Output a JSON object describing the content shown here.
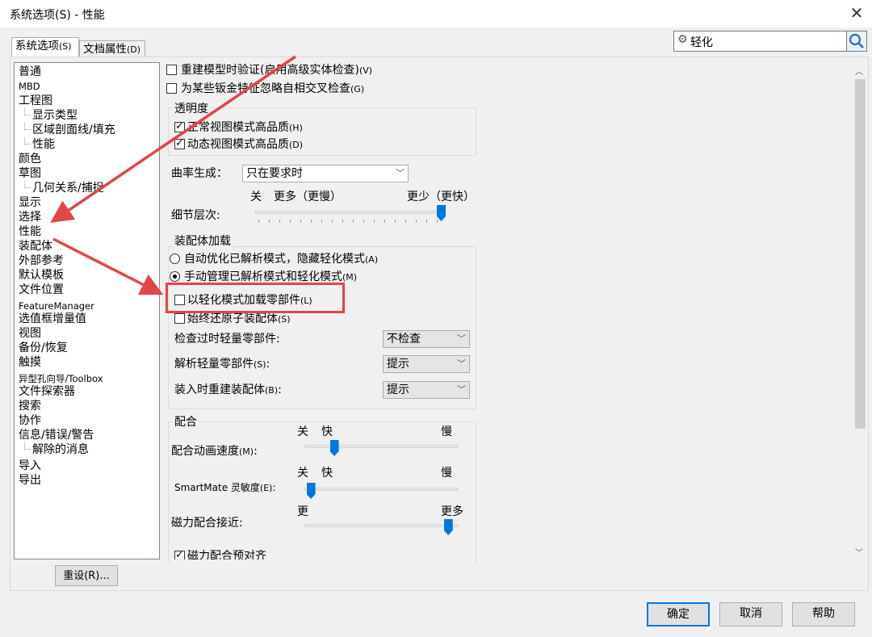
{
  "window": {
    "title": "系统选项(S) - 性能",
    "close_icon": "close-icon"
  },
  "tabs": [
    {
      "label": "系统选项",
      "shortcut": "(S)"
    },
    {
      "label": "文档属性",
      "shortcut": "(D)"
    }
  ],
  "search": {
    "value": "轻化",
    "gear_icon": "gear-icon",
    "search_icon": "search-icon"
  },
  "tree": {
    "items": [
      {
        "label": "普通"
      },
      {
        "label": "MBD"
      },
      {
        "label": "工程图"
      },
      {
        "label": "显示类型"
      },
      {
        "label": "区域剖面线/填充"
      },
      {
        "label": "性能"
      },
      {
        "label": "颜色"
      },
      {
        "label": "草图"
      },
      {
        "label": "几何关系/捕捉"
      },
      {
        "label": "显示"
      },
      {
        "label": "选择"
      },
      {
        "label": "性能"
      },
      {
        "label": "装配体"
      },
      {
        "label": "外部参考"
      },
      {
        "label": "默认模板"
      },
      {
        "label": "文件位置"
      },
      {
        "label": "FeatureManager"
      },
      {
        "label": "选值框增量值"
      },
      {
        "label": "视图"
      },
      {
        "label": "备份/恢复"
      },
      {
        "label": "触摸"
      },
      {
        "label": "异型孔向导/Toolbox"
      },
      {
        "label": "文件探索器"
      },
      {
        "label": "搜索"
      },
      {
        "label": "协作"
      },
      {
        "label": "信息/错误/警告"
      },
      {
        "label": "解除的消息"
      },
      {
        "label": "导入"
      },
      {
        "label": "导出"
      }
    ]
  },
  "settings": {
    "top_options": [
      {
        "label": "重建模型时验证(启用高级实体检查)",
        "shortcut": "(V)",
        "checked": false
      },
      {
        "label": "为某些钣金特征忽略自相交叉检查",
        "shortcut": "(G)",
        "checked": false
      }
    ],
    "transparency": {
      "title": "透明度",
      "options": [
        {
          "label": "正常视图模式高品质",
          "shortcut": "(H)",
          "checked": true
        },
        {
          "label": "动态视图模式高品质",
          "shortcut": "(D)",
          "checked": true
        }
      ]
    },
    "curvature": {
      "label": "曲率生成：",
      "value": "只在要求时"
    },
    "detail": {
      "label": "细节层次:",
      "left": "关",
      "left2": "更多（更慢）",
      "right": "更少（更快）",
      "level": 1.0
    },
    "assembly_loading": {
      "title": "装配体加载",
      "radios": [
        {
          "label": "自动优化已解析模式，隐藏轻化模式",
          "shortcut": "(A)",
          "checked": false
        },
        {
          "label": "手动管理已解析模式和轻化模式",
          "shortcut": "(M)",
          "checked": true
        }
      ],
      "checkboxes": [
        {
          "label": "以轻化模式加载零部件",
          "shortcut": "(L)",
          "checked": false
        },
        {
          "label": "始终还原子装配体",
          "shortcut": "(S)",
          "checked": false
        }
      ],
      "dropdowns": [
        {
          "label": "检查过时轻量零部件:",
          "shortcut": "",
          "value": "不检查"
        },
        {
          "label": "解析轻量零部件",
          "shortcut": "(S)",
          "suffix": ":",
          "value": "提示"
        },
        {
          "label": "装入时重建装配体",
          "shortcut": "(B)",
          "suffix": ":",
          "value": "提示"
        }
      ]
    },
    "mates": {
      "title": "配合",
      "sliders": [
        {
          "label": "配合动画速度",
          "shortcut": "(M)",
          "suffix": ":",
          "left": "关",
          "left2": "快",
          "right": "慢",
          "level": 0.18
        },
        {
          "label": "SmartMate 灵敏度",
          "shortcut": "(E)",
          "suffix": ":",
          "left": "关",
          "left2": "快",
          "right": "慢",
          "level": 0.02
        },
        {
          "label": "磁力配合接近:",
          "shortcut": "",
          "suffix": "",
          "left": "更",
          "left2": "",
          "right": "更多",
          "level": 0.96
        }
      ],
      "last_option": {
        "label": "磁力配合预对齐",
        "checked": true
      }
    }
  },
  "buttons": {
    "reset": "重设(R)...",
    "ok": "确定",
    "cancel": "取消",
    "help": "帮助"
  },
  "colors": {
    "accent": "#0078d7",
    "annotation": "#e2454a"
  }
}
